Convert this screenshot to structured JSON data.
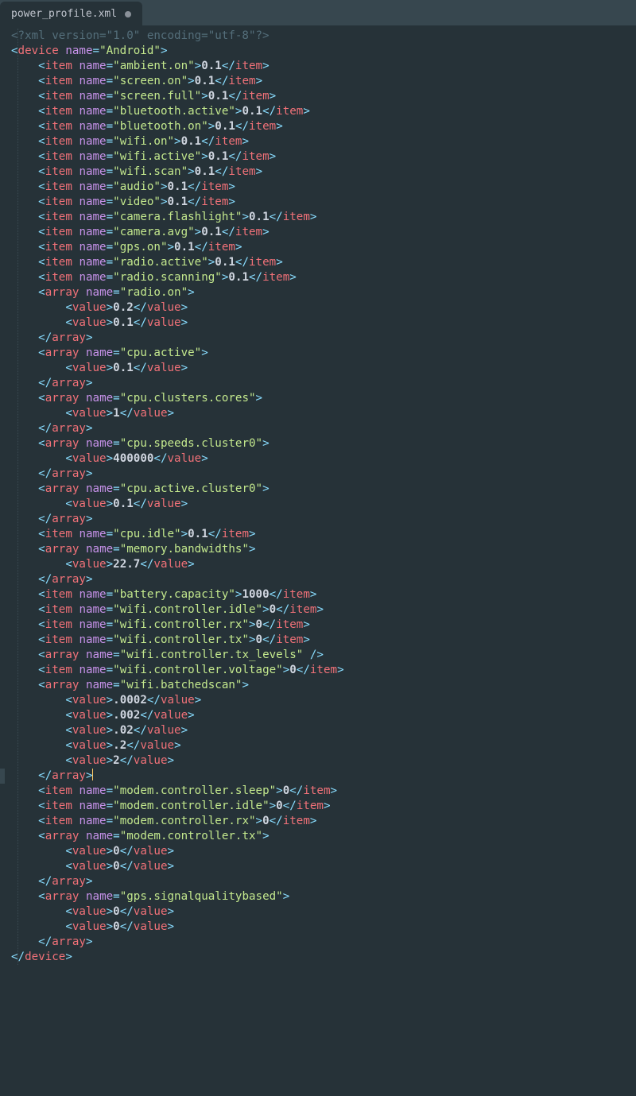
{
  "tab": {
    "filename": "power_profile.xml",
    "modified": true
  },
  "prolog": {
    "raw": "<?xml version=\"1.0\" encoding=\"utf-8\"?>"
  },
  "root": {
    "tag": "device",
    "attr_name": "name",
    "attr_value": "Android"
  },
  "lines": [
    {
      "kind": "item",
      "name": "ambient.on",
      "value": "0.1"
    },
    {
      "kind": "item",
      "name": "screen.on",
      "value": "0.1"
    },
    {
      "kind": "item",
      "name": "screen.full",
      "value": "0.1"
    },
    {
      "kind": "item",
      "name": "bluetooth.active",
      "value": "0.1"
    },
    {
      "kind": "item",
      "name": "bluetooth.on",
      "value": "0.1"
    },
    {
      "kind": "item",
      "name": "wifi.on",
      "value": "0.1"
    },
    {
      "kind": "item",
      "name": "wifi.active",
      "value": "0.1"
    },
    {
      "kind": "item",
      "name": "wifi.scan",
      "value": "0.1"
    },
    {
      "kind": "item",
      "name": "audio",
      "value": "0.1"
    },
    {
      "kind": "item",
      "name": "video",
      "value": "0.1"
    },
    {
      "kind": "item",
      "name": "camera.flashlight",
      "value": "0.1"
    },
    {
      "kind": "item",
      "name": "camera.avg",
      "value": "0.1"
    },
    {
      "kind": "item",
      "name": "gps.on",
      "value": "0.1"
    },
    {
      "kind": "item",
      "name": "radio.active",
      "value": "0.1"
    },
    {
      "kind": "item",
      "name": "radio.scanning",
      "value": "0.1"
    },
    {
      "kind": "array_open",
      "name": "radio.on"
    },
    {
      "kind": "value",
      "value": "0.2"
    },
    {
      "kind": "value",
      "value": "0.1"
    },
    {
      "kind": "array_close"
    },
    {
      "kind": "array_open",
      "name": "cpu.active"
    },
    {
      "kind": "value",
      "value": "0.1"
    },
    {
      "kind": "array_close"
    },
    {
      "kind": "array_open",
      "name": "cpu.clusters.cores"
    },
    {
      "kind": "value",
      "value": "1"
    },
    {
      "kind": "array_close"
    },
    {
      "kind": "array_open",
      "name": "cpu.speeds.cluster0"
    },
    {
      "kind": "value",
      "value": "400000"
    },
    {
      "kind": "array_close"
    },
    {
      "kind": "array_open",
      "name": "cpu.active.cluster0"
    },
    {
      "kind": "value",
      "value": "0.1"
    },
    {
      "kind": "array_close"
    },
    {
      "kind": "item",
      "name": "cpu.idle",
      "value": "0.1"
    },
    {
      "kind": "array_open",
      "name": "memory.bandwidths"
    },
    {
      "kind": "value",
      "value": "22.7"
    },
    {
      "kind": "array_close"
    },
    {
      "kind": "item",
      "name": "battery.capacity",
      "value": "1000"
    },
    {
      "kind": "item",
      "name": "wifi.controller.idle",
      "value": "0"
    },
    {
      "kind": "item",
      "name": "wifi.controller.rx",
      "value": "0"
    },
    {
      "kind": "item",
      "name": "wifi.controller.tx",
      "value": "0"
    },
    {
      "kind": "array_self",
      "name": "wifi.controller.tx_levels"
    },
    {
      "kind": "item",
      "name": "wifi.controller.voltage",
      "value": "0"
    },
    {
      "kind": "array_open",
      "name": "wifi.batchedscan"
    },
    {
      "kind": "value",
      "value": ".0002"
    },
    {
      "kind": "value",
      "value": ".002"
    },
    {
      "kind": "value",
      "value": ".02"
    },
    {
      "kind": "value",
      "value": ".2"
    },
    {
      "kind": "value",
      "value": "2"
    },
    {
      "kind": "array_close",
      "cursor": true
    },
    {
      "kind": "item",
      "name": "modem.controller.sleep",
      "value": "0"
    },
    {
      "kind": "item",
      "name": "modem.controller.idle",
      "value": "0"
    },
    {
      "kind": "item",
      "name": "modem.controller.rx",
      "value": "0"
    },
    {
      "kind": "array_open",
      "name": "modem.controller.tx"
    },
    {
      "kind": "value",
      "value": "0"
    },
    {
      "kind": "value",
      "value": "0"
    },
    {
      "kind": "array_close"
    },
    {
      "kind": "array_open",
      "name": "gps.signalqualitybased"
    },
    {
      "kind": "value",
      "value": "0"
    },
    {
      "kind": "value",
      "value": "0"
    },
    {
      "kind": "array_close"
    }
  ]
}
